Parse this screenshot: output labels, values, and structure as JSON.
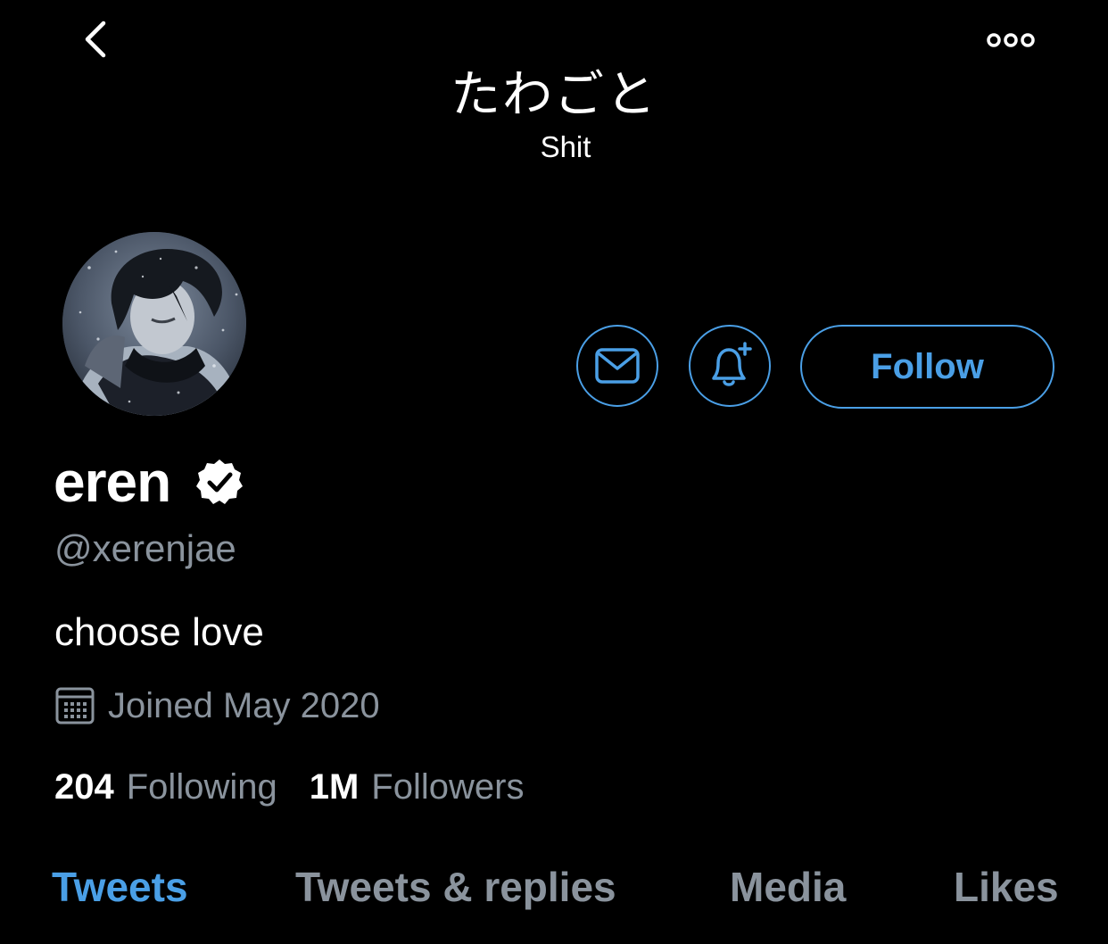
{
  "nav": {
    "back_icon": "chevron-left-icon",
    "more_icon": "more-dots-icon"
  },
  "banner": {
    "title": "たわごと",
    "subtitle": "Shit"
  },
  "profile": {
    "avatar_alt": "profile avatar",
    "display_name": "eren",
    "verified": true,
    "handle": "@xerenjae",
    "bio": "choose love",
    "joined": "Joined May 2020",
    "following_count": "204",
    "following_label": "Following",
    "followers_count": "1M",
    "followers_label": "Followers"
  },
  "actions": {
    "message_icon": "envelope-icon",
    "notify_icon": "bell-plus-icon",
    "follow_label": "Follow"
  },
  "tabs": [
    {
      "label": "Tweets",
      "active": true
    },
    {
      "label": "Tweets & replies",
      "active": false
    },
    {
      "label": "Media",
      "active": false
    },
    {
      "label": "Likes",
      "active": false
    }
  ],
  "colors": {
    "background": "#000000",
    "accent": "#4a9fe6",
    "secondary_text": "#8a939d",
    "primary_text": "#ffffff"
  }
}
